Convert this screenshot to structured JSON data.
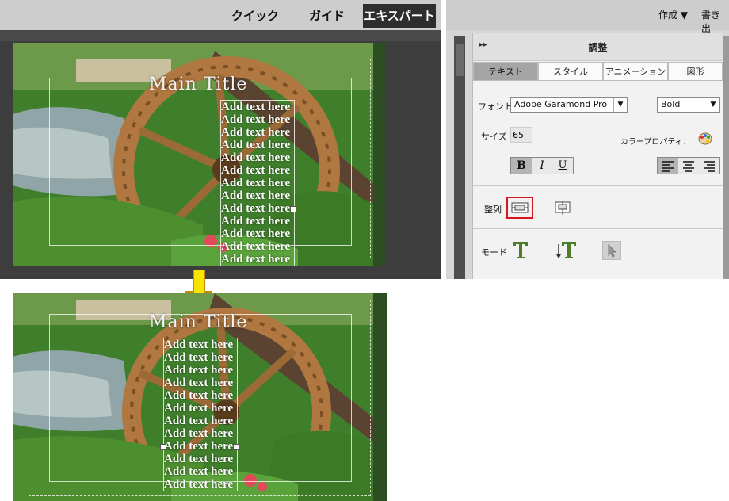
{
  "editor": {
    "mode_tabs": [
      "クイック",
      "ガイド",
      "エキスパート"
    ],
    "main_title": "Main Title",
    "add_text": "Add text here",
    "colors": {
      "accent": "#d8151c",
      "arrow": "#f7e400"
    }
  },
  "right_header": {
    "create_label": "作成",
    "export_label": "書き出"
  },
  "panel": {
    "title": "調整",
    "tabs": [
      "テキスト",
      "スタイル",
      "アニメーション",
      "図形"
    ],
    "font_label": "フォント",
    "font_value": "Adobe Garamond Pro",
    "font_style": "Bold",
    "size_label": "サイズ",
    "size_value": "65",
    "color_label": "カラープロパティ：",
    "bold_label": "B",
    "italic_label": "I",
    "underline_label": "U",
    "align_label": "整列",
    "mode_label": "モード"
  }
}
